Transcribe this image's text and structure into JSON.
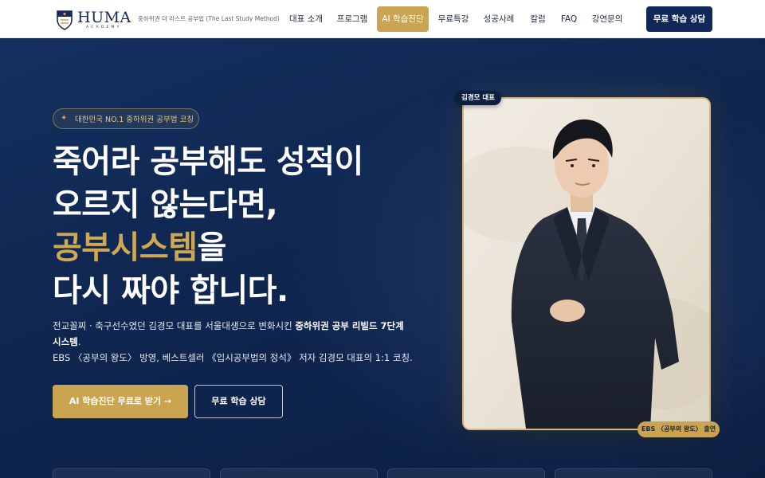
{
  "header": {
    "logo_name": "HUMA",
    "logo_sub": "ACADEMY",
    "tagline": "중하위권 더 라스트 공부법 (The Last Study Method)",
    "nav": [
      {
        "label": "대표 소개",
        "active": false
      },
      {
        "label": "프로그램",
        "active": false
      },
      {
        "label": "AI 학습진단",
        "active": true
      },
      {
        "label": "무료특강",
        "active": false
      },
      {
        "label": "성공사례",
        "active": false
      },
      {
        "label": "칼럼",
        "active": false
      },
      {
        "label": "FAQ",
        "active": false
      },
      {
        "label": "강연문의",
        "active": false
      }
    ],
    "cta_label": "무료 학습 상담"
  },
  "hero": {
    "eyebrow_icon": "sparkle-icon",
    "eyebrow": "대한민국 NO.1 중하위권 공부법 코칭",
    "headline": {
      "line1": "죽어라 공부해도 성적이",
      "line2": "오르지 않는다면,",
      "line3_highlight": "공부시스템",
      "line3_rest": "을",
      "line4": "다시 짜야 합니다."
    },
    "description": {
      "line1_text": "전교꼴찌 · 축구선수였던 김경모 대표를 서울대생으로 변화시킨 ",
      "line1_strong": "중하위권 공부 리빌드 7단계",
      "line2_strong": "시스템",
      "line2_rest": ".",
      "line3": "EBS 〈공부의 왕도〉 방영, 베스트셀러 《입시공부법의 정석》 저자 김경모 대표의 1:1 코칭."
    },
    "primary_button": "AI 학습진단 무료로 받기 →",
    "secondary_button": "무료 학습 상담",
    "name_tag": "김경모 대표",
    "ebs_tag": "EBS 〈공부의 왕도〉 출연"
  },
  "colors": {
    "navy": "#0f2347",
    "gold": "#c9a451",
    "header_bg": "#ffffff"
  }
}
